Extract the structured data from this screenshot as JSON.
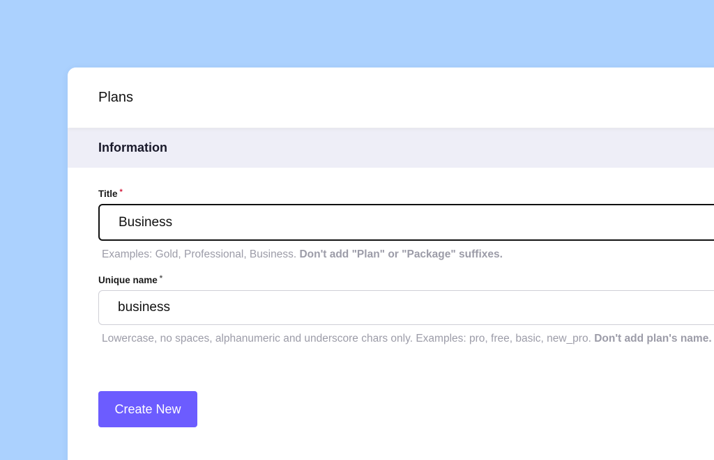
{
  "header": {
    "title": "Plans"
  },
  "section": {
    "title": "Information"
  },
  "fields": {
    "title": {
      "label": "Title",
      "required_mark": "*",
      "value": "Business",
      "help_text": "Examples: Gold, Professional, Business. ",
      "help_emphasis": "Don't add \"Plan\" or \"Package\" suffixes."
    },
    "unique_name": {
      "label": "Unique name",
      "required_mark": "*",
      "value": "business",
      "help_text": "Lowercase, no spaces, alphanumeric and underscore chars only. Examples: pro, free, basic, new_pro. ",
      "help_emphasis": "Don't add plan's name."
    }
  },
  "actions": {
    "create_label": "Create New"
  },
  "colors": {
    "background": "#abd1fe",
    "section_bar": "#eeeef7",
    "primary_button": "#6c5cff",
    "required_star": "#d31b3c",
    "help_text": "#9c9ca8"
  }
}
